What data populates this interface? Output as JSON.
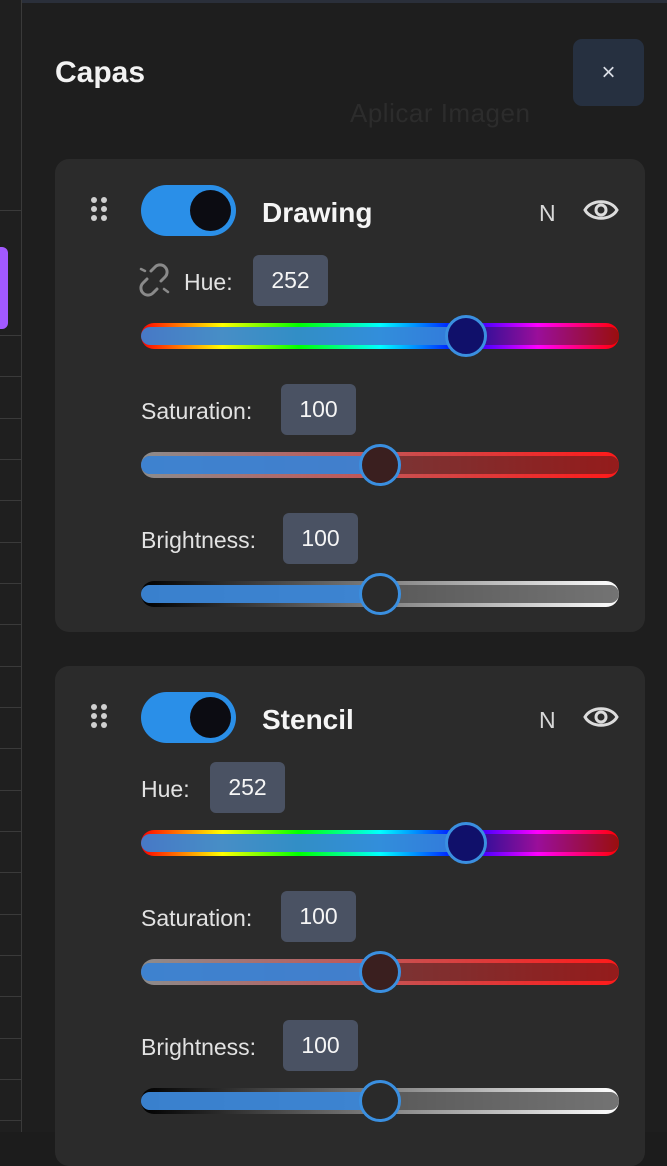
{
  "panel": {
    "title": "Capas",
    "close_label": "×",
    "background_text": "Aplicar Imagen"
  },
  "colors": {
    "accent": "#2a8fe8",
    "card_bg": "#2b2b2b",
    "value_box_bg": "#4a5263",
    "sidebar_accent": "#a259ff"
  },
  "layers": [
    {
      "name": "Drawing",
      "blend_mode": "N",
      "enabled": true,
      "visible": true,
      "has_link_icon": true,
      "hue_label": "Hue:",
      "hue_value": "252",
      "hue_fraction": 0.68,
      "saturation_label": "Saturation:",
      "saturation_value": "100",
      "saturation_fraction": 0.5,
      "brightness_label": "Brightness:",
      "brightness_value": "100",
      "brightness_fraction": 0.5
    },
    {
      "name": "Stencil",
      "blend_mode": "N",
      "enabled": true,
      "visible": true,
      "has_link_icon": false,
      "hue_label": "Hue:",
      "hue_value": "252",
      "hue_fraction": 0.68,
      "saturation_label": "Saturation:",
      "saturation_value": "100",
      "saturation_fraction": 0.5,
      "brightness_label": "Brightness:",
      "brightness_value": "100",
      "brightness_fraction": 0.5
    }
  ]
}
